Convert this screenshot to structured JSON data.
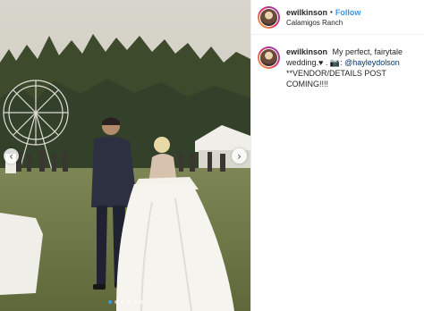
{
  "post": {
    "username": "ewilkinson",
    "separator": "•",
    "follow_label": "Follow",
    "location": "Calamigos Ranch",
    "caption": {
      "username": "ewilkinson",
      "line1": "My perfect, fairytale",
      "line2": "wedding.",
      "emoji_part": "♥ . 📷:",
      "mention": "@hayleydolson",
      "line3": "**VENDOR/DETAILS POST COMING!!!!"
    }
  },
  "carousel": {
    "prev_glyph": "‹",
    "next_glyph": "›",
    "slide_count": 6,
    "active_index": 0
  },
  "theme": {
    "accent": "#3897f0",
    "mention_color": "#003569",
    "text": "#262626"
  }
}
